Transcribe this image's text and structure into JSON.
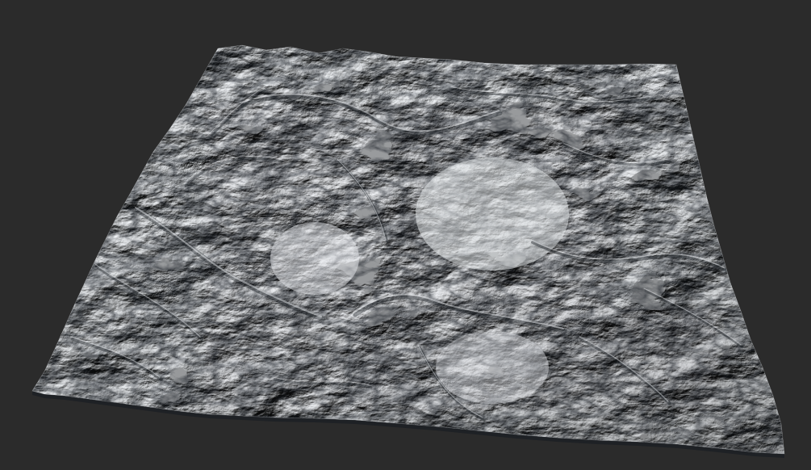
{
  "scene": {
    "background_color": "#2b2b2b",
    "subject": "terrain-heightmap-render",
    "surface_color": "#c9ccd1",
    "highlight_color": "#eef0f3",
    "shadow_color": "#3a3f47",
    "deep_shadow_color": "#1c2026"
  }
}
